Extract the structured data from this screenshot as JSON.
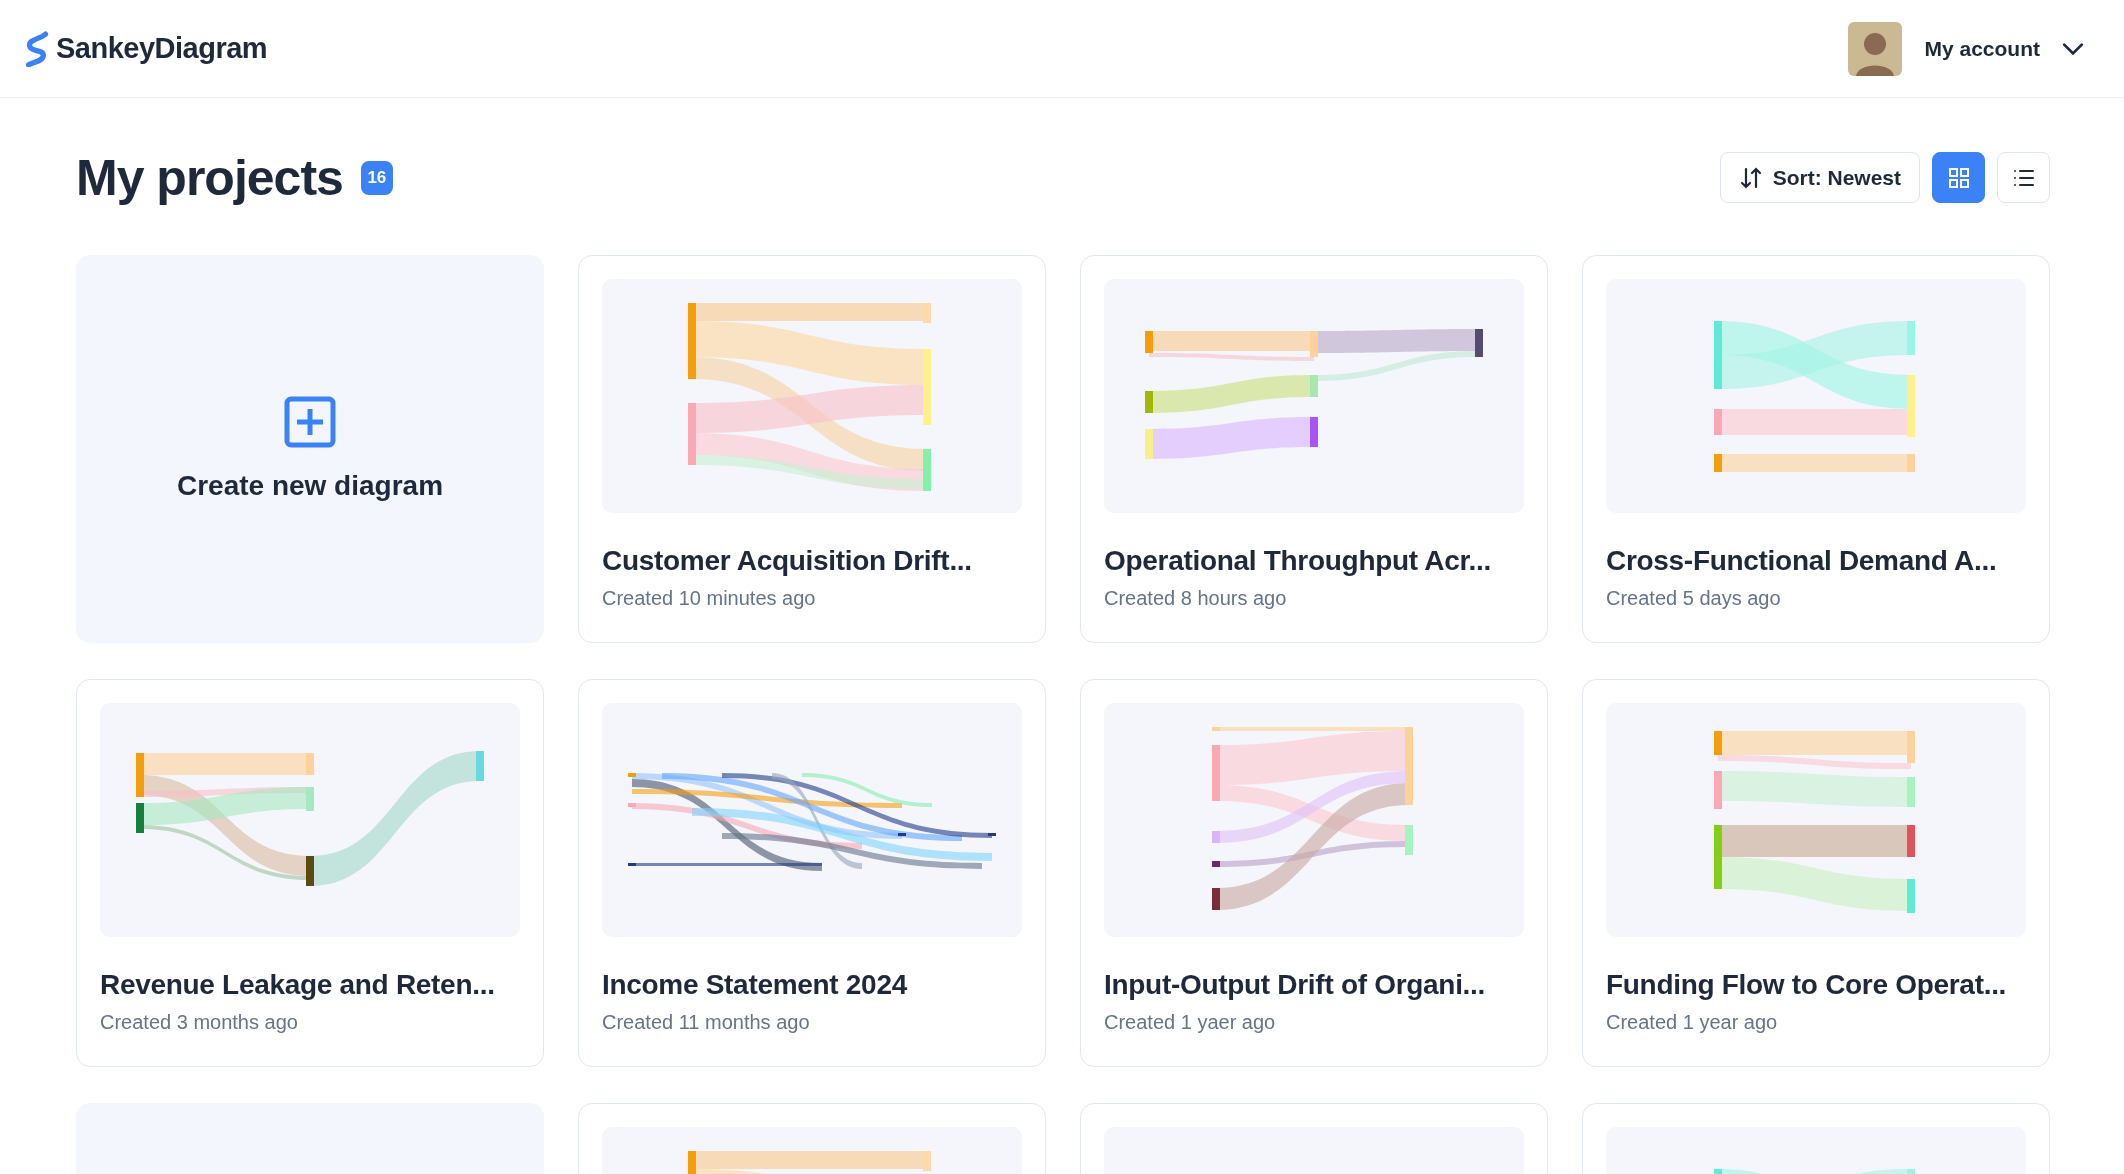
{
  "header": {
    "logo": "SankeyDiagram",
    "account": "My account"
  },
  "page": {
    "title": "My projects",
    "count": "16",
    "sort": "Sort: Newest",
    "views": [
      {
        "kind": "grid",
        "selected": true
      },
      {
        "kind": "list",
        "selected": false
      }
    ]
  },
  "create_card": {
    "label": "Create new diagram"
  },
  "projects": [
    {
      "title": "Customer Acquisition Drift...",
      "created": "Created 10 minutes ago"
    },
    {
      "title": "Operational Throughput Acr...",
      "created": "Created 8 hours ago"
    },
    {
      "title": "Cross-Functional Demand A...",
      "created": "Created 5 days ago"
    },
    {
      "title": "Revenue Leakage and Reten...",
      "created": "Created 3 months ago"
    },
    {
      "title": "Income Statement 2024",
      "created": "Created 11 months ago"
    },
    {
      "title": "Input-Output Drift of Organi...",
      "created": "Created 1 yaer ago"
    },
    {
      "title": "Funding Flow to Core Operat...",
      "created": "Created 1 year ago"
    }
  ],
  "partial_row": [
    {
      "kind": "blank"
    },
    {
      "kind": "thumbnail"
    },
    {
      "kind": "thumbnail"
    },
    {
      "kind": "thumbnail"
    }
  ]
}
